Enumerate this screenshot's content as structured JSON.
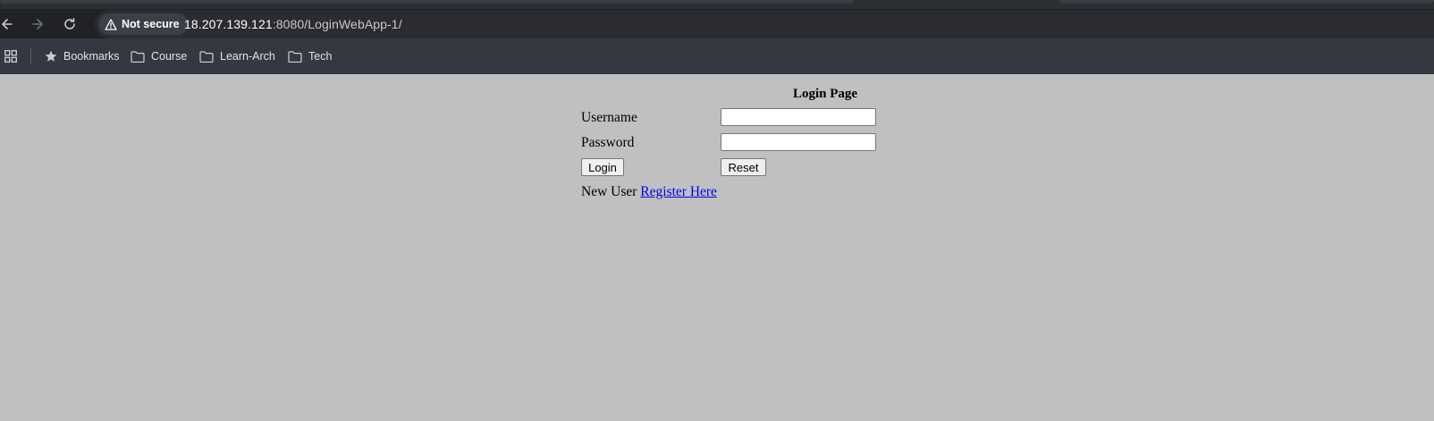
{
  "browser": {
    "security_label": "Not secure",
    "url_host": "18.207.139.121",
    "url_rest": ":8080/LoginWebApp-1/",
    "bookmarks": [
      {
        "label": "Bookmarks",
        "icon": "star-icon"
      },
      {
        "label": "Course",
        "icon": "folder-icon"
      },
      {
        "label": "Learn-Arch",
        "icon": "folder-icon"
      },
      {
        "label": "Tech",
        "icon": "folder-icon"
      }
    ]
  },
  "login": {
    "title": "Login Page",
    "username_label": "Username",
    "username_value": "",
    "password_label": "Password",
    "password_value": "",
    "login_button": "Login",
    "reset_button": "Reset",
    "new_user_text": "New User",
    "register_link": "Register Here"
  },
  "colors": {
    "page_background": "#c0c0c0",
    "link": "#0000ee",
    "toolbar": "#202226",
    "bookmarks_bar": "#353840"
  }
}
